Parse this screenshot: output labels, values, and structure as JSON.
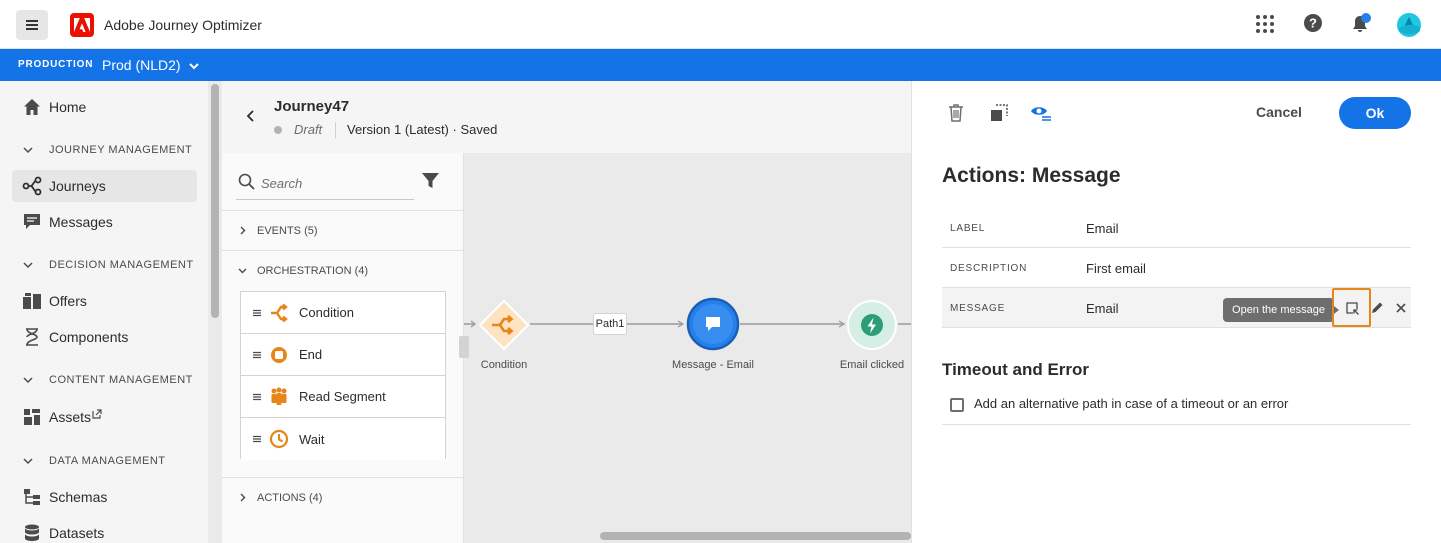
{
  "app": {
    "title": "Adobe Journey Optimizer"
  },
  "env": {
    "label": "PRODUCTION",
    "name": "Prod (NLD2)"
  },
  "nav": {
    "home": "Home",
    "sections": {
      "journey": "JOURNEY MANAGEMENT",
      "decision": "DECISION MANAGEMENT",
      "content": "CONTENT MANAGEMENT",
      "data": "DATA MANAGEMENT"
    },
    "items": {
      "journeys": "Journeys",
      "messages": "Messages",
      "offers": "Offers",
      "components": "Components",
      "assets": "Assets",
      "schemas": "Schemas",
      "datasets": "Datasets"
    },
    "active": "Journeys"
  },
  "journey": {
    "name": "Journey47",
    "status": "Draft",
    "version": "Version 1 (Latest) · Saved"
  },
  "palette": {
    "search_placeholder": "Search",
    "events": "EVENTS (5)",
    "orchestration": "ORCHESTRATION (4)",
    "orchestration_items": [
      "Condition",
      "End",
      "Read Segment",
      "Wait"
    ],
    "actions": "ACTIONS (4)"
  },
  "canvas": {
    "nodes": [
      "Condition",
      "Message - Email",
      "Email clicked"
    ],
    "path_label": "Path1"
  },
  "panel": {
    "cancel": "Cancel",
    "ok": "Ok",
    "title": "Actions: Message",
    "fields": [
      {
        "key": "LABEL",
        "value": "Email"
      },
      {
        "key": "DESCRIPTION",
        "value": "First email"
      },
      {
        "key": "MESSAGE",
        "value": "Email"
      }
    ],
    "tooltip": "Open the message",
    "timeout_title": "Timeout and Error",
    "timeout_option": "Add an alternative path in case of a timeout or an error"
  },
  "colors": {
    "accent": "#1473e6",
    "orange": "#e68619",
    "condition": "#f29423",
    "event_green": "#2d9d78"
  }
}
